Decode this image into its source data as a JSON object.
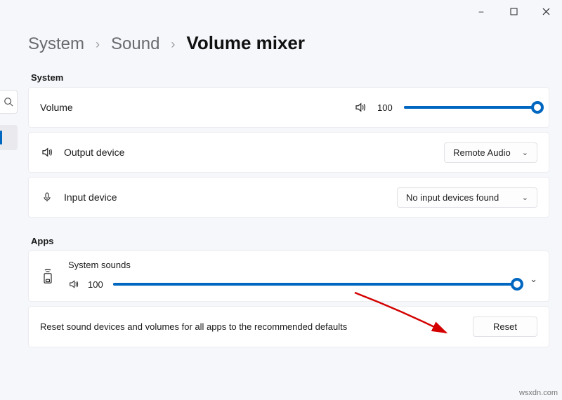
{
  "window": {
    "minimize": "–",
    "maximize": "◻",
    "close": "✕"
  },
  "breadcrumb": {
    "lvl1": "System",
    "lvl2": "Sound",
    "current": "Volume mixer",
    "sep": "›"
  },
  "sections": {
    "system": "System",
    "apps": "Apps"
  },
  "system": {
    "volume_label": "Volume",
    "volume_value": "100",
    "output_label": "Output device",
    "output_value": "Remote Audio",
    "input_label": "Input device",
    "input_value": "No input devices found"
  },
  "apps": {
    "item1_title": "System sounds",
    "item1_value": "100"
  },
  "reset": {
    "text": "Reset sound devices and volumes for all apps to the recommended defaults",
    "button": "Reset"
  },
  "watermark": "wsxdn.com"
}
